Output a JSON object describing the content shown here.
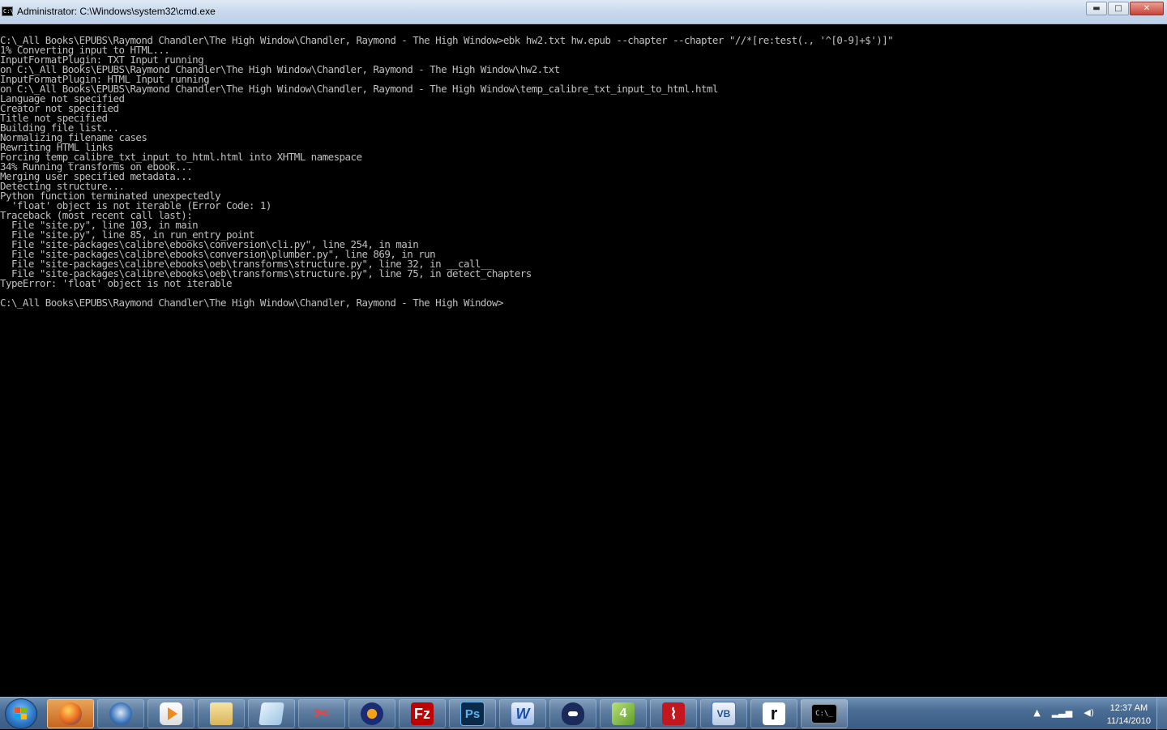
{
  "window": {
    "title": "Administrator: C:\\Windows\\system32\\cmd.exe",
    "icon": "cmd-icon",
    "controls": {
      "minimize": "▬",
      "maximize": "□",
      "close": "✕"
    }
  },
  "console": {
    "lines": [
      "C:\\_All Books\\EPUBS\\Raymond Chandler\\The High Window\\Chandler, Raymond - The High Window>ebk hw2.txt hw.epub --chapter --chapter \"//*[re:test(., '^[0-9]+$')]\"",
      "1% Converting input to HTML...",
      "InputFormatPlugin: TXT Input running",
      "on C:\\_All Books\\EPUBS\\Raymond Chandler\\The High Window\\Chandler, Raymond - The High Window\\hw2.txt",
      "InputFormatPlugin: HTML Input running",
      "on C:\\_All Books\\EPUBS\\Raymond Chandler\\The High Window\\Chandler, Raymond - The High Window\\temp_calibre_txt_input_to_html.html",
      "Language not specified",
      "Creator not specified",
      "Title not specified",
      "Building file list...",
      "Normalizing filename cases",
      "Rewriting HTML links",
      "Forcing temp_calibre_txt_input_to_html.html into XHTML namespace",
      "34% Running transforms on ebook...",
      "Merging user specified metadata...",
      "Detecting structure...",
      "Python function terminated unexpectedly",
      "  'float' object is not iterable (Error Code: 1)",
      "Traceback (most recent call last):",
      "  File \"site.py\", line 103, in main",
      "  File \"site.py\", line 85, in run_entry_point",
      "  File \"site-packages\\calibre\\ebooks\\conversion\\cli.py\", line 254, in main",
      "  File \"site-packages\\calibre\\ebooks\\conversion\\plumber.py\", line 869, in run",
      "  File \"site-packages\\calibre\\ebooks\\oeb\\transforms\\structure.py\", line 32, in __call__",
      "  File \"site-packages\\calibre\\ebooks\\oeb\\transforms\\structure.py\", line 75, in detect_chapters",
      "TypeError: 'float' object is not iterable",
      "",
      "C:\\_All Books\\EPUBS\\Raymond Chandler\\The High Window\\Chandler, Raymond - The High Window>"
    ],
    "text_color": "#c0c0c0",
    "background": "#000000"
  },
  "taskbar": {
    "apps": [
      {
        "name": "firefox-icon",
        "active": true
      },
      {
        "name": "thunderbird-icon",
        "active": false
      },
      {
        "name": "media-player-icon",
        "active": false
      },
      {
        "name": "file-explorer-icon",
        "active": false
      },
      {
        "name": "notepad-icon",
        "active": false
      },
      {
        "name": "snipping-tool-icon",
        "active": false
      },
      {
        "name": "audacity-icon",
        "active": false
      },
      {
        "name": "filezilla-icon",
        "label": "Fz",
        "active": false
      },
      {
        "name": "photoshop-icon",
        "label": "Ps",
        "active": false
      },
      {
        "name": "word-icon",
        "label": "W",
        "active": false
      },
      {
        "name": "batman-icon",
        "active": false
      },
      {
        "name": "green-app-icon",
        "label": "4",
        "active": false
      },
      {
        "name": "acrobat-icon",
        "active": false
      },
      {
        "name": "visual-basic-icon",
        "label": "VB",
        "active": false
      },
      {
        "name": "r-icon",
        "label": "r",
        "active": false
      },
      {
        "name": "cmd-icon",
        "label": "C:\\_",
        "active": true
      }
    ],
    "clock": {
      "time": "12:37 AM",
      "date": "11/14/2010"
    }
  }
}
